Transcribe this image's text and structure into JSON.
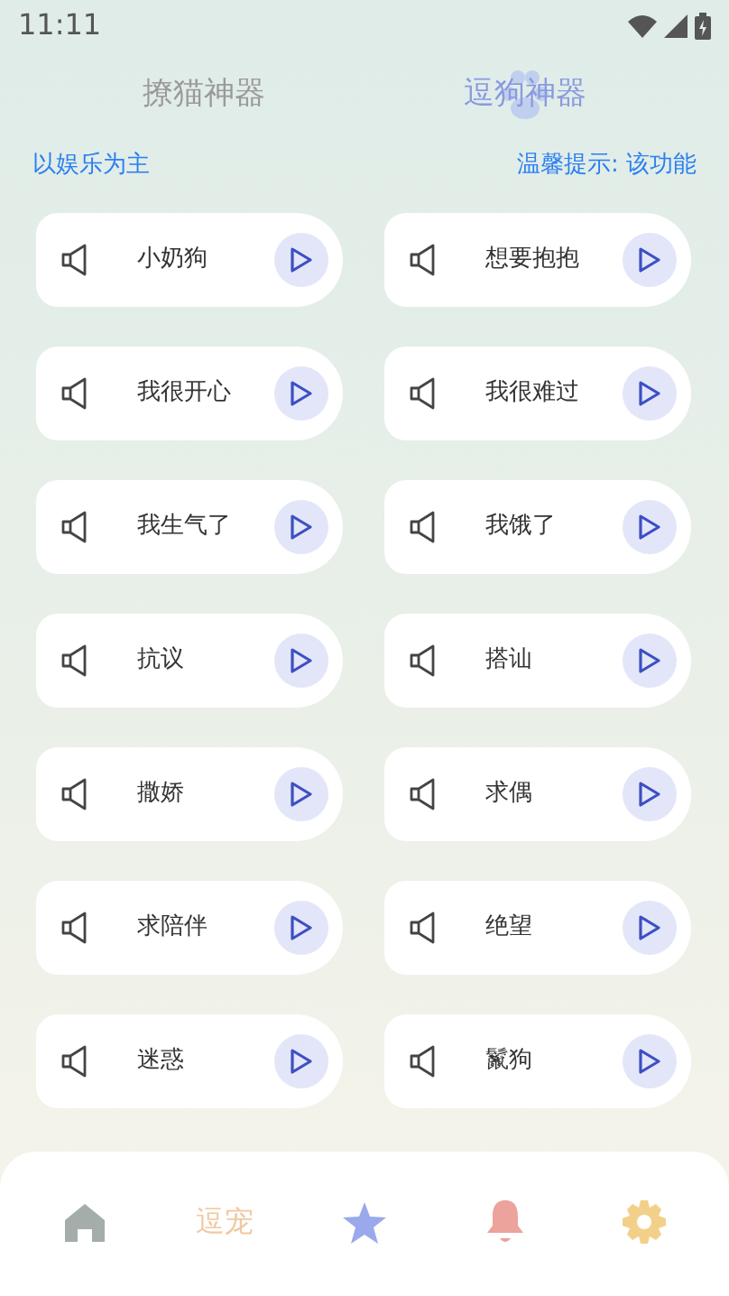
{
  "status_bar": {
    "time": "11:11"
  },
  "tabs": [
    {
      "label": "撩猫神器",
      "selected": false
    },
    {
      "label": "逗狗神器",
      "selected": true
    }
  ],
  "notice": {
    "left": "以娱乐为主",
    "right": "温馨提示: 该功能"
  },
  "sounds": [
    {
      "label": "小奶狗"
    },
    {
      "label": "想要抱抱"
    },
    {
      "label": "我很开心"
    },
    {
      "label": "我很难过"
    },
    {
      "label": "我生气了"
    },
    {
      "label": "我饿了"
    },
    {
      "label": "抗议"
    },
    {
      "label": "搭讪"
    },
    {
      "label": "撒娇"
    },
    {
      "label": "求偶"
    },
    {
      "label": "求陪伴"
    },
    {
      "label": "绝望"
    },
    {
      "label": "迷惑"
    },
    {
      "label": "鬣狗"
    }
  ],
  "bottom_nav": [
    {
      "kind": "home",
      "color": "#a5adab"
    },
    {
      "kind": "text",
      "label": "逗宠",
      "color": "#f0c9a2"
    },
    {
      "kind": "star",
      "color": "#9aa8ec"
    },
    {
      "kind": "bell",
      "color": "#eba39b"
    },
    {
      "kind": "gear",
      "color": "#f3d08a"
    }
  ]
}
